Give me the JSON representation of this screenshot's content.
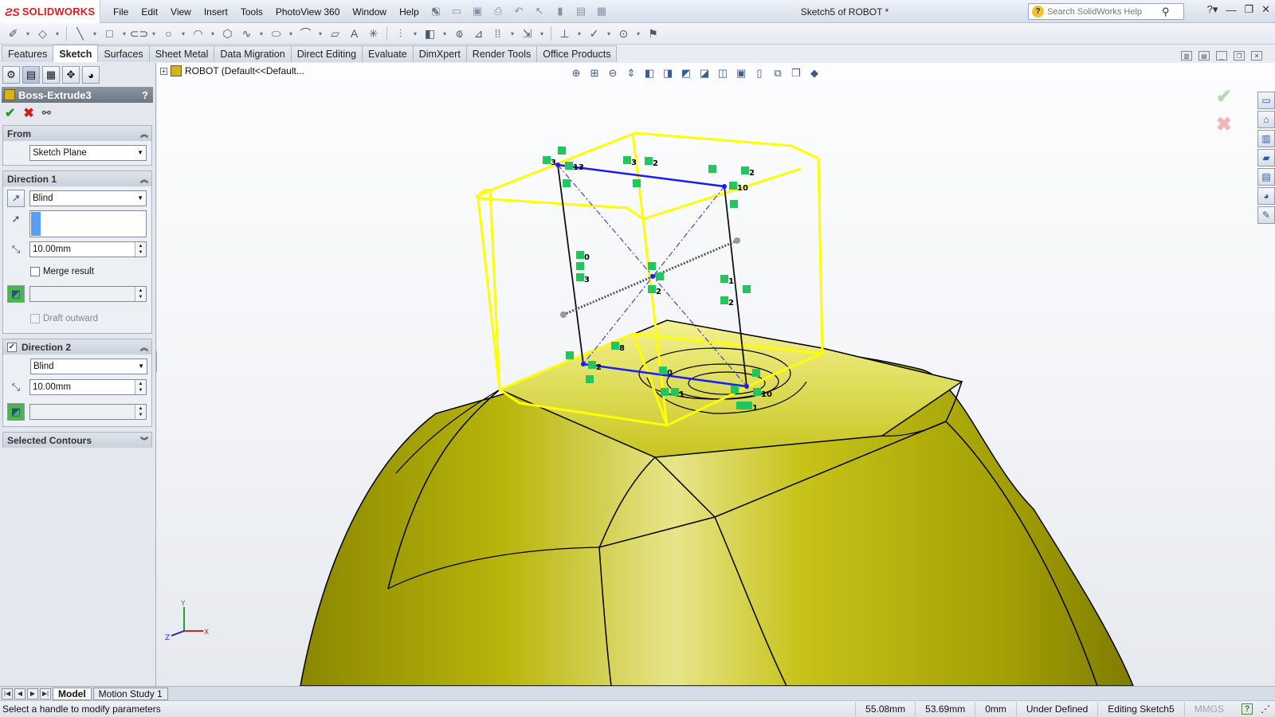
{
  "app": {
    "brand": "SOLIDWORKS",
    "document_title": "Sketch5 of ROBOT *",
    "menus": [
      "File",
      "Edit",
      "View",
      "Insert",
      "Tools",
      "PhotoView 360",
      "Window",
      "Help"
    ],
    "search_placeholder": "Search SolidWorks Help"
  },
  "command_tabs": [
    "Features",
    "Sketch",
    "Surfaces",
    "Sheet Metal",
    "Data Migration",
    "Direct Editing",
    "Evaluate",
    "DimXpert",
    "Render Tools",
    "Office Products"
  ],
  "active_tab": "Sketch",
  "property_manager": {
    "title": "Boss-Extrude3",
    "help": "?",
    "from": {
      "label": "From",
      "value": "Sketch Plane"
    },
    "direction1": {
      "label": "Direction 1",
      "end_condition": "Blind",
      "depth": "10.00mm",
      "merge_result": "Merge result",
      "draft_outward": "Draft outward"
    },
    "direction2": {
      "label": "Direction 2",
      "end_condition": "Blind",
      "depth": "10.00mm"
    },
    "selected_contours": {
      "label": "Selected Contours"
    }
  },
  "viewport": {
    "tree_root": "ROBOT  (Default<<Default...",
    "triad": {
      "x": "X",
      "y": "Y",
      "z": "Z"
    },
    "sketch_labels": [
      "3",
      "13",
      "3",
      "2",
      "2",
      "10",
      "0",
      "3",
      "1",
      "2",
      "2",
      "8",
      "2",
      "0",
      "1",
      "10",
      "1"
    ],
    "colors": {
      "part_body": "#b9b60e",
      "preview_outline": "#ffff00",
      "sketch_line": "#1a1aff",
      "relation_icon": "#22c55e"
    }
  },
  "bottom_tabs": [
    "Model",
    "Motion Study 1"
  ],
  "status_bar": {
    "message": "Select a handle to modify parameters",
    "x": "55.08mm",
    "y": "53.69mm",
    "z": "0mm",
    "sketch_state": "Under Defined",
    "editing": "Editing Sketch5",
    "units": "MMGS"
  }
}
